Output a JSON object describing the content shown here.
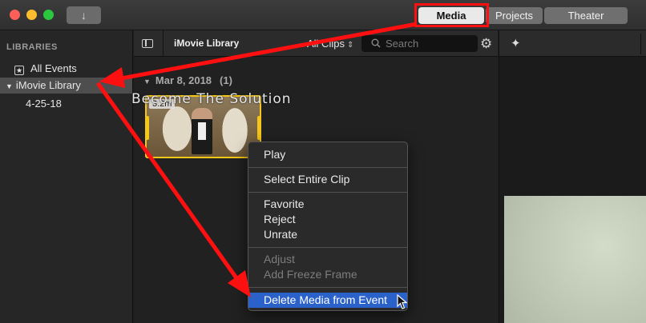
{
  "titlebar": {
    "import_icon": "down-arrow-icon",
    "import_glyph": "↓",
    "tabs": [
      {
        "label": "Media",
        "selected": true
      },
      {
        "label": "Projects",
        "selected": false
      },
      {
        "label": "Theater",
        "selected": false
      }
    ]
  },
  "sidebar": {
    "heading": "LIBRARIES",
    "all_events": "All Events",
    "library": "iMovie Library",
    "event": "4-25-18"
  },
  "browser": {
    "library_title": "iMovie Library",
    "filter": "All Clips",
    "search_placeholder": "Search",
    "date": "Mar 8, 2018",
    "count": "(1)",
    "clip_duration": "3.2m"
  },
  "watermark": "Become The Solution",
  "context_menu": {
    "items": [
      {
        "label": "Play",
        "enabled": true
      },
      {
        "label": "Select Entire Clip",
        "enabled": true
      },
      {
        "label": "Favorite",
        "enabled": true
      },
      {
        "label": "Reject",
        "enabled": true
      },
      {
        "label": "Unrate",
        "enabled": true
      },
      {
        "label": "Adjust",
        "enabled": false
      },
      {
        "label": "Add Freeze Frame",
        "enabled": false
      },
      {
        "label": "Delete Media from Event",
        "enabled": true,
        "highlighted": true
      }
    ]
  },
  "colors": {
    "annotation": "#ff1010",
    "selection": "#2a62c9",
    "clip_border": "#f5c518"
  }
}
